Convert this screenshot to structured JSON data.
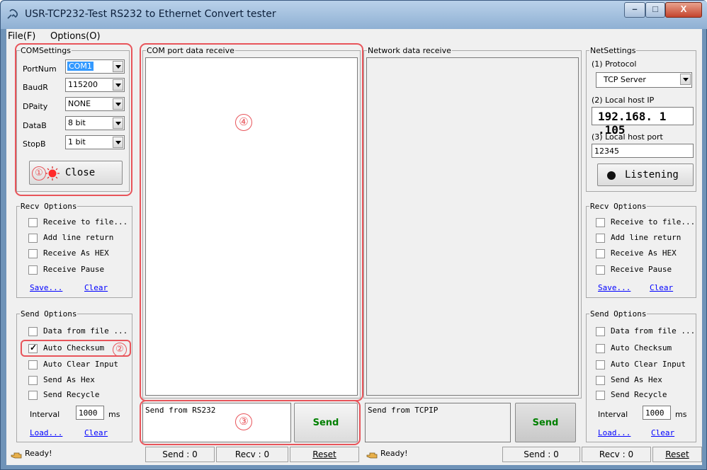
{
  "window": {
    "title": "USR-TCP232-Test  RS232 to Ethernet Convert tester",
    "minimize": "–",
    "maximize": "□",
    "close": "X"
  },
  "menu": {
    "file": "File(F)",
    "options": "Options(O)"
  },
  "com_settings": {
    "legend": "COMSettings",
    "port_label": "PortNum",
    "port_value": "COM1",
    "baud_label": "BaudR",
    "baud_value": "115200",
    "parity_label": "DPaity",
    "parity_value": "NONE",
    "databits_label": "DataB",
    "databits_value": "8 bit",
    "stopbits_label": "StopB",
    "stopbits_value": "1 bit",
    "close_label": "Close"
  },
  "left_recv_options": {
    "legend": "Recv Options",
    "items": [
      "Receive to file...",
      "Add line return",
      "Receive As HEX",
      "Receive Pause"
    ],
    "save": "Save...",
    "clear": "Clear"
  },
  "left_send_options": {
    "legend": "Send Options",
    "items": [
      "Data from file ...",
      "Auto Checksum",
      "Auto Clear Input",
      "Send As Hex",
      "Send Recycle"
    ],
    "checked": [
      false,
      true,
      false,
      false,
      false
    ],
    "interval_label": "Interval",
    "interval_value": "1000",
    "interval_unit": "ms",
    "load": "Load...",
    "clear": "Clear"
  },
  "com_receive": {
    "legend": "COM port data receive"
  },
  "net_receive": {
    "legend": "Network data receive"
  },
  "com_send": {
    "text": "Send from RS232",
    "button": "Send"
  },
  "net_send": {
    "text": "Send from TCPIP",
    "button": "Send"
  },
  "net_settings": {
    "legend": "NetSettings",
    "protocol_label": "(1) Protocol",
    "protocol_value": "TCP Server",
    "ip_label": "(2) Local host IP",
    "ip_value": "192.168. 1 .105",
    "port_label": "(3) Local host port",
    "port_value": "12345",
    "listen_label": "Listening"
  },
  "right_recv_options": {
    "legend": "Recv Options",
    "items": [
      "Receive to file...",
      "Add line return",
      "Receive As HEX",
      "Receive Pause"
    ],
    "save": "Save...",
    "clear": "Clear"
  },
  "right_send_options": {
    "legend": "Send Options",
    "items": [
      "Data from file ...",
      "Auto Checksum",
      "Auto Clear Input",
      "Send As Hex",
      "Send Recycle"
    ],
    "interval_label": "Interval",
    "interval_value": "1000",
    "interval_unit": "ms",
    "load": "Load...",
    "clear": "Clear"
  },
  "status_left": {
    "ready": "Ready!",
    "send": "Send : 0",
    "recv": "Recv : 0",
    "reset": "Reset"
  },
  "status_right": {
    "ready": "Ready!",
    "send": "Send : 0",
    "recv": "Recv : 0",
    "reset": "Reset"
  },
  "annotations": {
    "one": "①",
    "two": "②",
    "three": "③",
    "four": "④"
  },
  "icons": {
    "app": "connector-icon",
    "led_red": "red-led-icon",
    "led_black": "black-led-icon",
    "status": "hand-pointer-icon"
  }
}
